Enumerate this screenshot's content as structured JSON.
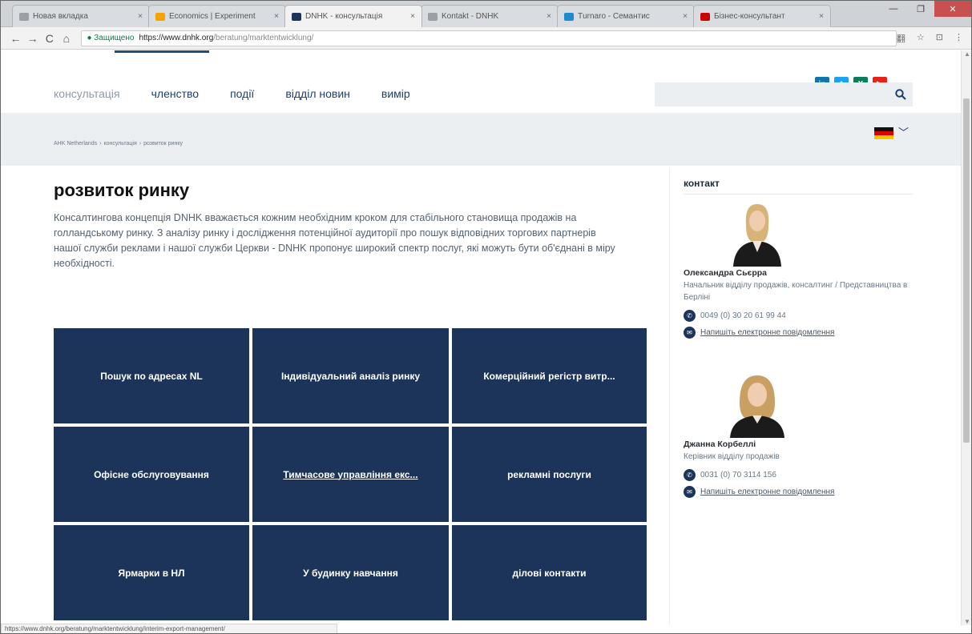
{
  "browser": {
    "tabs": [
      {
        "title": "Новая вкладка",
        "active": false,
        "fav": "#9aa0a6"
      },
      {
        "title": "Economics | Experiment",
        "active": false,
        "fav": "#f4a300"
      },
      {
        "title": "DNHK - консультація",
        "active": true,
        "fav": "#1c3459"
      },
      {
        "title": "Kontakt - DNHK",
        "active": false,
        "fav": "#9aa0a6"
      },
      {
        "title": "Тurnaro - Cемантиc",
        "active": false,
        "fav": "#1e8bd1"
      },
      {
        "title": "Бізнес-консультант",
        "active": false,
        "fav": "#c00"
      }
    ],
    "tab_close": "×",
    "window_buttons": {
      "minimize": "—",
      "maximize": "❐",
      "close": "✕"
    },
    "nav": {
      "back": "←",
      "forward": "→",
      "reload": "C",
      "home": "⌂"
    },
    "secure_label": "● Защищено",
    "url_host": "https://www.dnhk.org",
    "url_path": "/beratung/marktentwicklung/",
    "right_icons": [
      "翻",
      "☆",
      "⊡",
      "⋮"
    ],
    "status_url": "https://www.dnhk.org/beratung/marktentwicklung/interim-export-management/"
  },
  "header": {
    "social": [
      {
        "label": "in",
        "color": "#0e76a8"
      },
      {
        "label": "t",
        "color": "#1da1f2"
      },
      {
        "label": "X",
        "color": "#0b7c5b"
      },
      {
        "label": "▶",
        "color": "#e62117"
      }
    ],
    "nav": [
      {
        "label": "консультація",
        "active": true
      },
      {
        "label": "членство",
        "active": false
      },
      {
        "label": "події",
        "active": false
      },
      {
        "label": "відділ новин",
        "active": false
      },
      {
        "label": "вимір",
        "active": false
      }
    ],
    "search_placeholder": "",
    "search_icon": "🔍"
  },
  "breadcrumb": [
    "AHK Netherlands",
    "›",
    "консультація",
    "›",
    "розвиток ринку"
  ],
  "language_chevron": "﹀",
  "main": {
    "title": "розвиток ринку",
    "lead": "Консалтингова концепція DNHK вважається кожним необхідним кроком для стабільного становища продажів на голландському ринку. З аналізу ринку і дослідження потенційної аудиторії про пошук відповідних торгових партнерів нашої служби реклами і нашої служби Церкви - DNHK пропонує широкий спектр послуг, які можуть бути об'єднані в міру необхідності.",
    "tiles": [
      "Пошук по адресах NL",
      "Індивідуальний аналіз ринку",
      "Комерційний регістр витр...",
      "Офісне обслуговування",
      "Тимчасове управління екс...",
      "рекламні послуги",
      "Ярмарки в НЛ",
      "У будинку навчання",
      "ділові контакти"
    ]
  },
  "sidebar": {
    "title": "контакт",
    "contacts": [
      {
        "name": "Олександра Сьєрра",
        "role": "Начальник відділу продажів, консалтинг / Представництва в Берліні",
        "phone": "0049 (0) 30 20 61 99 44",
        "email_label": "Напишіть електронне повідомлення"
      },
      {
        "name": "Джанна Корбеллі",
        "role": "Керівник відділу продажів",
        "phone": "0031 (0) 70 3114 156",
        "email_label": "Напишіть електронне повідомлення"
      }
    ],
    "phone_icon": "✆",
    "email_icon": "✉"
  }
}
